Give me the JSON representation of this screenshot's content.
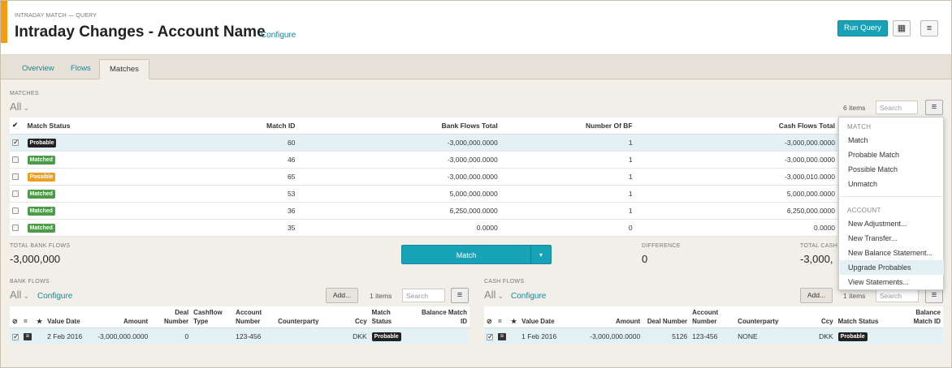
{
  "header": {
    "eyebrow": "INTRADAY MATCH — QUERY",
    "title": "Intraday Changes - Account Name",
    "configure": "Configure",
    "run_query": "Run Query",
    "grid_icon": "grid-icon",
    "menu_icon": "hamburger-icon"
  },
  "tabs": [
    {
      "label": "Overview"
    },
    {
      "label": "Flows"
    },
    {
      "label": "Matches",
      "active": true
    }
  ],
  "matches": {
    "section_label": "MATCHES",
    "filter": "All",
    "count": "6 items",
    "search_placeholder": "Search",
    "columns": [
      "Match Status",
      "Match ID",
      "Bank Flows Total",
      "Number Of BF",
      "Cash Flows Total"
    ],
    "rows": [
      {
        "checked": true,
        "status": "Probable",
        "match_id": "60",
        "bank_total": "-3,000,000.0000",
        "num_bf": "1",
        "cash_total": "-3,000,000.0000"
      },
      {
        "checked": false,
        "status": "Matched",
        "match_id": "46",
        "bank_total": "-3,000,000.0000",
        "num_bf": "1",
        "cash_total": "-3,000,000.0000"
      },
      {
        "checked": false,
        "status": "Possible",
        "match_id": "65",
        "bank_total": "-3,000,000.0000",
        "num_bf": "1",
        "cash_total": "-3,000,010.0000"
      },
      {
        "checked": false,
        "status": "Matched",
        "match_id": "53",
        "bank_total": "5,000,000.0000",
        "num_bf": "1",
        "cash_total": "5,000,000.0000"
      },
      {
        "checked": false,
        "status": "Matched",
        "match_id": "36",
        "bank_total": "6,250,000.0000",
        "num_bf": "1",
        "cash_total": "6,250,000.0000"
      },
      {
        "checked": false,
        "status": "Matched",
        "match_id": "35",
        "bank_total": "0.0000",
        "num_bf": "0",
        "cash_total": "0.0000"
      }
    ]
  },
  "totals": {
    "bank_label": "TOTAL BANK FLOWS",
    "bank_value": "-3,000,000",
    "match_button": "Match",
    "diff_label": "DIFFERENCE",
    "diff_value": "0",
    "cash_label": "TOTAL CASH",
    "cash_value": "-3,000,"
  },
  "bank_flows": {
    "section_label": "BANK FLOWS",
    "filter": "All",
    "configure": "Configure",
    "add": "Add...",
    "count": "1 items",
    "search_placeholder": "Search",
    "columns": {
      "eq": "=",
      "star": "★",
      "value_date": "Value Date",
      "amount": "Amount",
      "deal_number": "Deal Number",
      "cashflow_type": "Cashflow Type",
      "account_number": "Account Number",
      "counterparty": "Counterparty",
      "ccy": "Ccy",
      "match_status": "Match Status",
      "balance_match_id": "Balance Match ID"
    },
    "rows": [
      {
        "value_date": "2 Feb 2016",
        "amount": "-3,000,000.0000",
        "deal_number": "0",
        "cashflow_type": "",
        "account_number": "123-456",
        "counterparty": "",
        "ccy": "DKK",
        "match_status": "Probable",
        "balance_match_id": ""
      }
    ]
  },
  "cash_flows": {
    "section_label": "CASH FLOWS",
    "filter": "All",
    "configure": "Configure",
    "add": "Add...",
    "count": "1 items",
    "search_placeholder": "Search",
    "columns": {
      "eq": "=",
      "star": "★",
      "value_date": "Value Date",
      "amount": "Amount",
      "deal_number": "Deal Number",
      "account_number": "Account Number",
      "counterparty": "Counterparty",
      "ccy": "Ccy",
      "match_status": "Match Status",
      "balance_match_id": "Balance Match ID"
    },
    "rows": [
      {
        "value_date": "1 Feb 2016",
        "amount": "-3,000,000.0000",
        "deal_number": "5126",
        "account_number": "123-456",
        "counterparty": "NONE",
        "ccy": "DKK",
        "match_status": "Probable",
        "balance_match_id": ""
      }
    ]
  },
  "menu": {
    "match_header": "MATCH",
    "match_items": [
      "Match",
      "Probable Match",
      "Possible Match",
      "Unmatch"
    ],
    "account_header": "ACCOUNT",
    "account_items": [
      "New Adjustment...",
      "New Transfer...",
      "New Balance Statement...",
      "Upgrade Probables",
      "View Statements..."
    ]
  },
  "colors": {
    "accent": "#f39c12",
    "primary": "#17a2b8",
    "link": "#16879c",
    "probable": "#222222",
    "matched": "#4e9a4b",
    "possible": "#f0a020"
  }
}
